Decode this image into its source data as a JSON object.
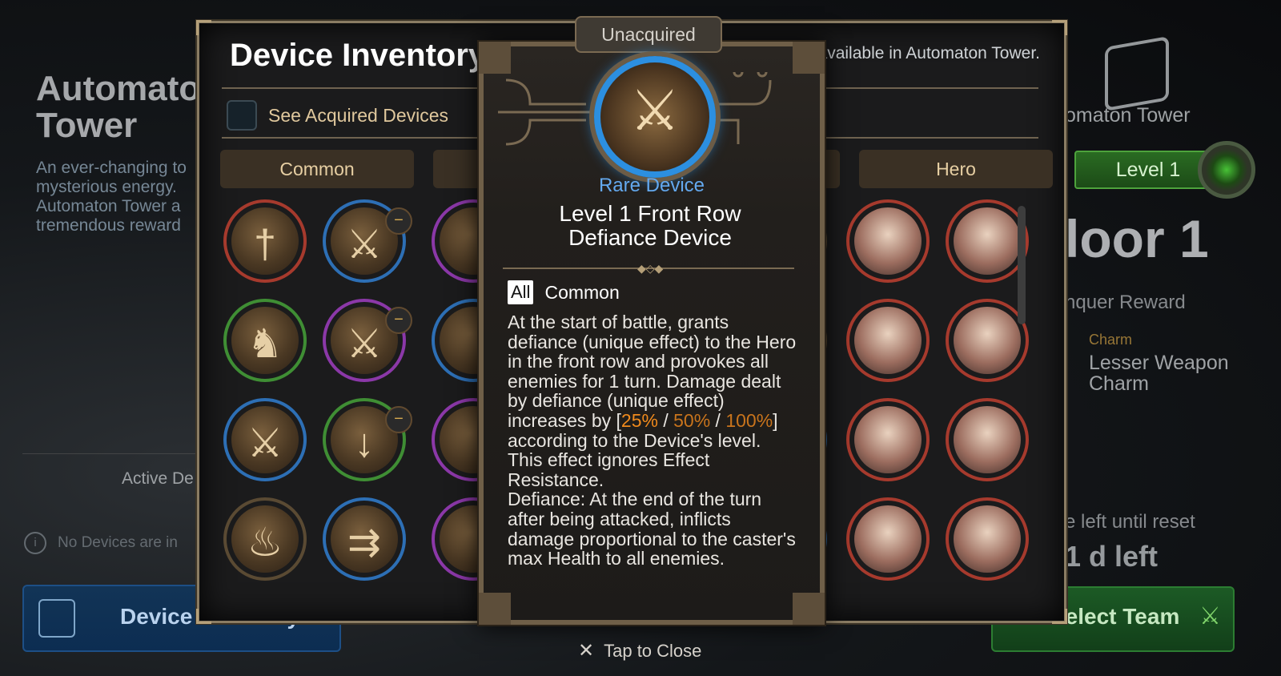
{
  "background": {
    "left": {
      "title": "Automaton\nTower",
      "description": "An ever-changing to\nmysterious energy.\nAutomaton Tower a\ntremendous reward",
      "active_label": "Active De",
      "no_devices_text": "No Devices are in",
      "inventory_button": "Device Inventory"
    },
    "right": {
      "tower_label": "omaton Tower",
      "level_label": "Level 1",
      "floor_label": "loor 1",
      "conquer_label": "nquer Reward",
      "charm_header": "Charm",
      "charm_name": "Lesser Weapon\nCharm",
      "reset_label": "e left until reset",
      "days_left": "1  d left",
      "select_team_button": "Select Team"
    }
  },
  "inventory": {
    "title": "Device Inventory",
    "subtitle": "s available in Automaton Tower.",
    "see_acquired_label": "See Acquired Devices",
    "tabs": [
      {
        "label": "Common"
      },
      {
        "label": ""
      },
      {
        "label": ""
      },
      {
        "label": "Hero"
      }
    ],
    "badge_symbol": "−"
  },
  "popup": {
    "status": "Unacquired",
    "rarity": "Rare Device",
    "name": "Level 1 Front Row Defiance Device",
    "tag_all": "All",
    "tag_type": "Common",
    "desc_part1": "At the start of battle, grants defiance (unique effect) to the Hero in the front row and provokes all enemies for 1 turn. Damage dealt by defiance (unique effect) increases by [",
    "val1": "25%",
    "sep1": " / ",
    "val2": "50%",
    "sep2": " / ",
    "val3": "100%",
    "desc_part2": "] according to the Device's level. This effect ignores Effect Resistance.",
    "desc_part3": "Defiance: At the end of the turn after being attacked, inflicts damage proportional to the caster's max Health to all enemies.",
    "icon": "sword-icon"
  },
  "footer": {
    "tap_to_close": "Tap to Close"
  },
  "colors": {
    "rare": "#64a9ef",
    "highlight": "#f08a1c",
    "level_green": "#2a6b22"
  }
}
